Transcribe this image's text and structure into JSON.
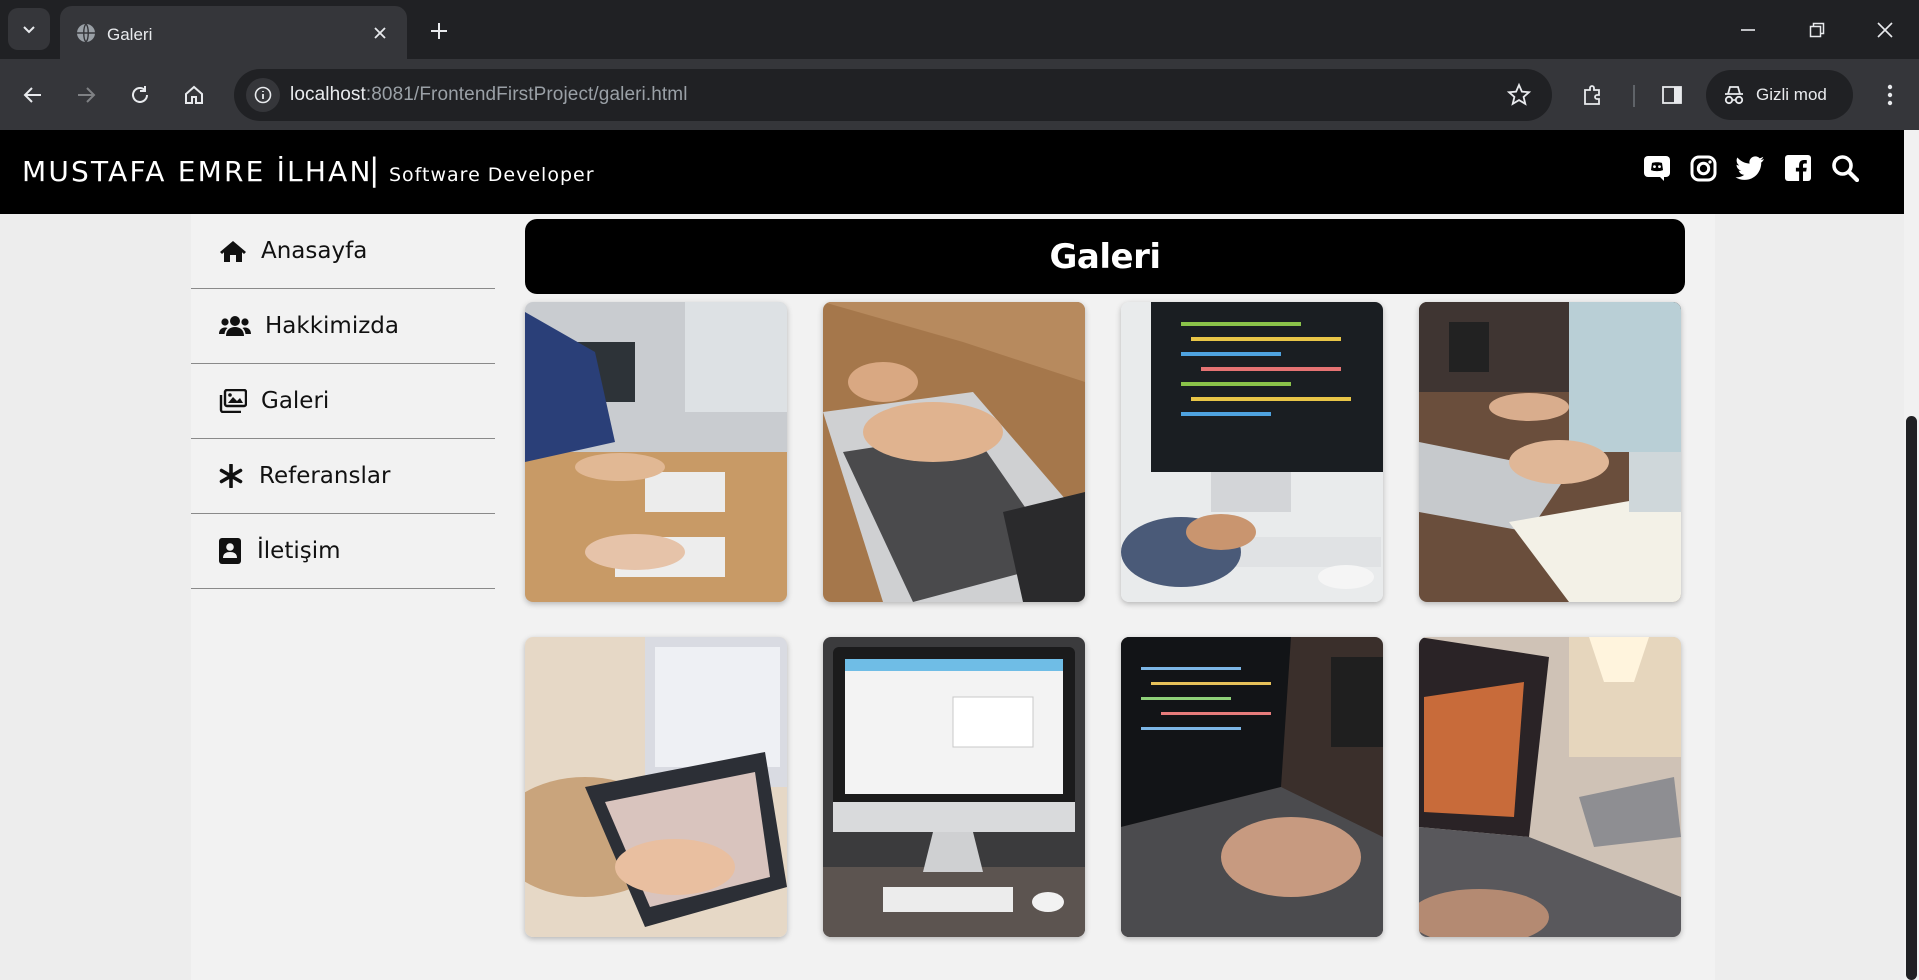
{
  "browser": {
    "tab_title": "Galeri",
    "url_host": "localhost",
    "url_rest": ":8081/FrontendFirstProject/galeri.html",
    "incognito_label": "Gizli mod"
  },
  "site": {
    "brand_name": "MUSTAFA EMRE İLHAN",
    "brand_separator": "|",
    "brand_role": "Software Developer",
    "social_icons": [
      "discord-icon",
      "instagram-icon",
      "twitter-icon",
      "facebook-icon",
      "search-icon"
    ]
  },
  "sidebar": {
    "items": [
      {
        "label": "Anasayfa",
        "icon": "home-icon"
      },
      {
        "label": "Hakkimizda",
        "icon": "users-icon"
      },
      {
        "label": "Galeri",
        "icon": "images-icon"
      },
      {
        "label": "Referanslar",
        "icon": "asterisk-icon"
      },
      {
        "label": "İletişim",
        "icon": "contact-card-icon"
      }
    ]
  },
  "gallery": {
    "title": "Galeri",
    "photos": [
      {
        "subject": "people typing on keyboards at office desk"
      },
      {
        "subject": "hands typing on laptop on wooden table"
      },
      {
        "subject": "code on desktop monitor with keyboard"
      },
      {
        "subject": "person typing on laptop with watch"
      },
      {
        "subject": "hand touching tablet screen"
      },
      {
        "subject": "imac with calendar application"
      },
      {
        "subject": "laptop with code, hands typing"
      },
      {
        "subject": "laptop on desk with lamp"
      }
    ]
  },
  "colors": {
    "header_bg": "#000000",
    "chrome_dark": "#202124",
    "chrome_toolbar": "#35363a",
    "page_bg": "#ededed",
    "content_bg": "#f2f2f2"
  }
}
